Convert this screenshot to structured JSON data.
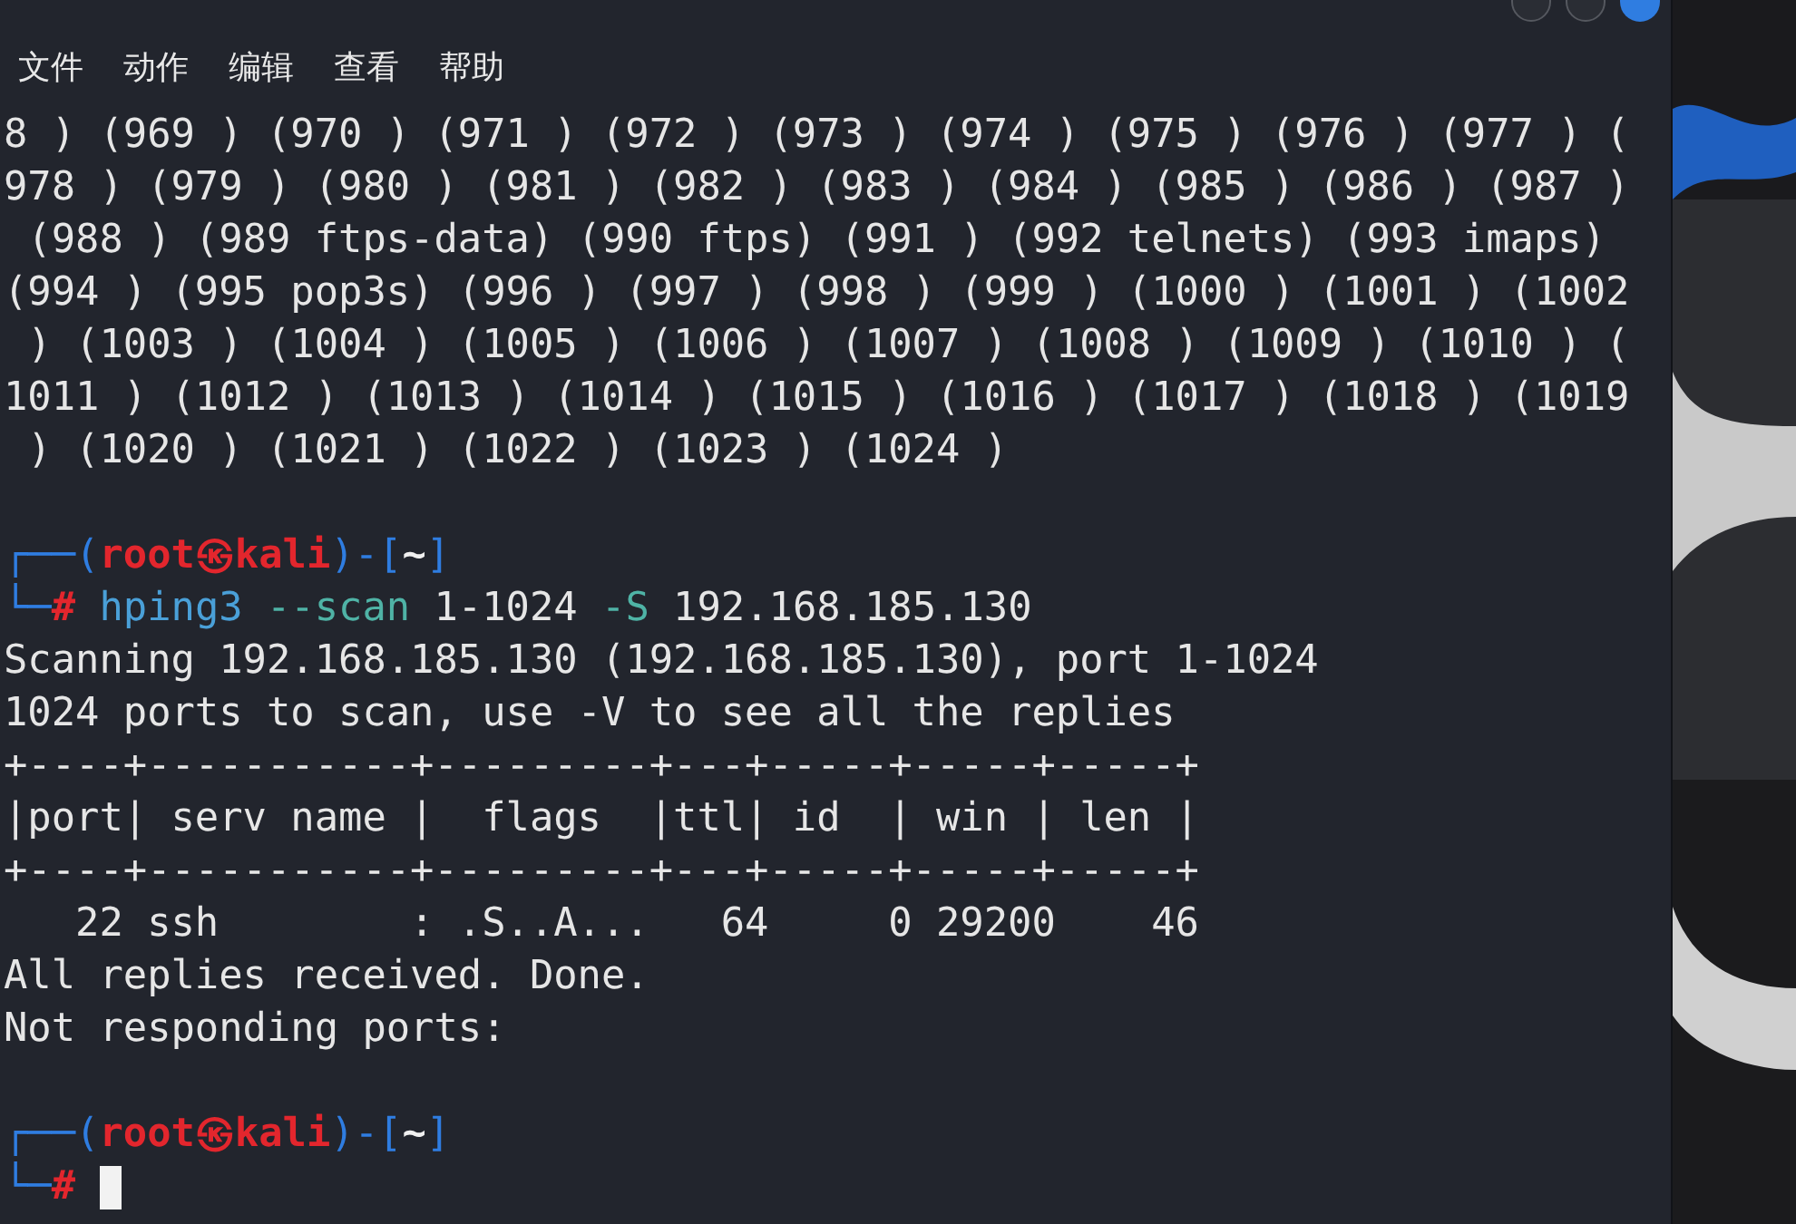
{
  "menu": [
    {
      "label": "文件"
    },
    {
      "label": "动作"
    },
    {
      "label": "编辑"
    },
    {
      "label": "查看"
    },
    {
      "label": "帮助"
    }
  ],
  "terminal": {
    "blocks": [
      {
        "lines": [
          {
            "segments": [
              {
                "kind": "plain",
                "text": "8 ) (969 ) (970 ) (971 ) (972 ) (973 ) (974 ) (975 ) (976 ) (977 ) ("
              }
            ]
          },
          {
            "segments": [
              {
                "kind": "plain",
                "text": "978 ) (979 ) (980 ) (981 ) (982 ) (983 ) (984 ) (985 ) (986 ) (987 )"
              }
            ]
          },
          {
            "segments": [
              {
                "kind": "plain",
                "text": " (988 ) (989 ftps-data) (990 ftps) (991 ) (992 telnets) (993 imaps)"
              }
            ]
          },
          {
            "segments": [
              {
                "kind": "plain",
                "text": "(994 ) (995 pop3s) (996 ) (997 ) (998 ) (999 ) (1000 ) (1001 ) (1002"
              }
            ]
          },
          {
            "segments": [
              {
                "kind": "plain",
                "text": " ) (1003 ) (1004 ) (1005 ) (1006 ) (1007 ) (1008 ) (1009 ) (1010 ) ("
              }
            ]
          },
          {
            "segments": [
              {
                "kind": "plain",
                "text": "1011 ) (1012 ) (1013 ) (1014 ) (1015 ) (1016 ) (1017 ) (1018 ) (1019"
              }
            ]
          },
          {
            "segments": [
              {
                "kind": "plain",
                "text": " ) (1020 ) (1021 ) (1022 ) (1023 ) (1024 )"
              }
            ]
          }
        ]
      },
      {
        "lines": [
          {
            "segments": [
              {
                "kind": "frame",
                "text": "┌──("
              },
              {
                "kind": "user",
                "text": "root㉿kali"
              },
              {
                "kind": "frame",
                "text": ")-["
              },
              {
                "kind": "dir",
                "text": "~"
              },
              {
                "kind": "frame",
                "text": "]"
              }
            ]
          },
          {
            "segments": [
              {
                "kind": "frame",
                "text": "└─"
              },
              {
                "kind": "hash",
                "text": "#"
              },
              {
                "kind": "command",
                "text": " hping3"
              },
              {
                "kind": "option",
                "text": " --scan"
              },
              {
                "kind": "plain",
                "text": " 1-1024 "
              },
              {
                "kind": "option",
                "text": "-S"
              },
              {
                "kind": "plain",
                "text": " 192.168.185.130"
              }
            ]
          },
          {
            "segments": [
              {
                "kind": "plain",
                "text": "Scanning 192.168.185.130 (192.168.185.130), port 1-1024"
              }
            ]
          },
          {
            "segments": [
              {
                "kind": "plain",
                "text": "1024 ports to scan, use -V to see all the replies"
              }
            ]
          },
          {
            "segments": [
              {
                "kind": "plain",
                "text": "+----+-----------+---------+---+-----+-----+-----+"
              }
            ]
          },
          {
            "segments": [
              {
                "kind": "plain",
                "text": "|port| serv name |  flags  |ttl| id  | win | len |"
              }
            ]
          },
          {
            "segments": [
              {
                "kind": "plain",
                "text": "+----+-----------+---------+---+-----+-----+-----+"
              }
            ]
          },
          {
            "segments": [
              {
                "kind": "plain",
                "text": "   22 ssh        : .S..A...   64     0 29200    46"
              }
            ]
          },
          {
            "segments": [
              {
                "kind": "plain",
                "text": "All replies received. Done."
              }
            ]
          },
          {
            "segments": [
              {
                "kind": "plain",
                "text": "Not responding ports:"
              }
            ]
          }
        ]
      },
      {
        "lines": [
          {
            "segments": [
              {
                "kind": "frame",
                "text": "┌──("
              },
              {
                "kind": "user",
                "text": "root㉿kali"
              },
              {
                "kind": "frame",
                "text": ")-["
              },
              {
                "kind": "dir",
                "text": "~"
              },
              {
                "kind": "frame",
                "text": "]"
              }
            ]
          },
          {
            "segments": [
              {
                "kind": "frame",
                "text": "└─"
              },
              {
                "kind": "hash",
                "text": "#"
              }
            ],
            "cursor": true
          }
        ]
      }
    ]
  }
}
